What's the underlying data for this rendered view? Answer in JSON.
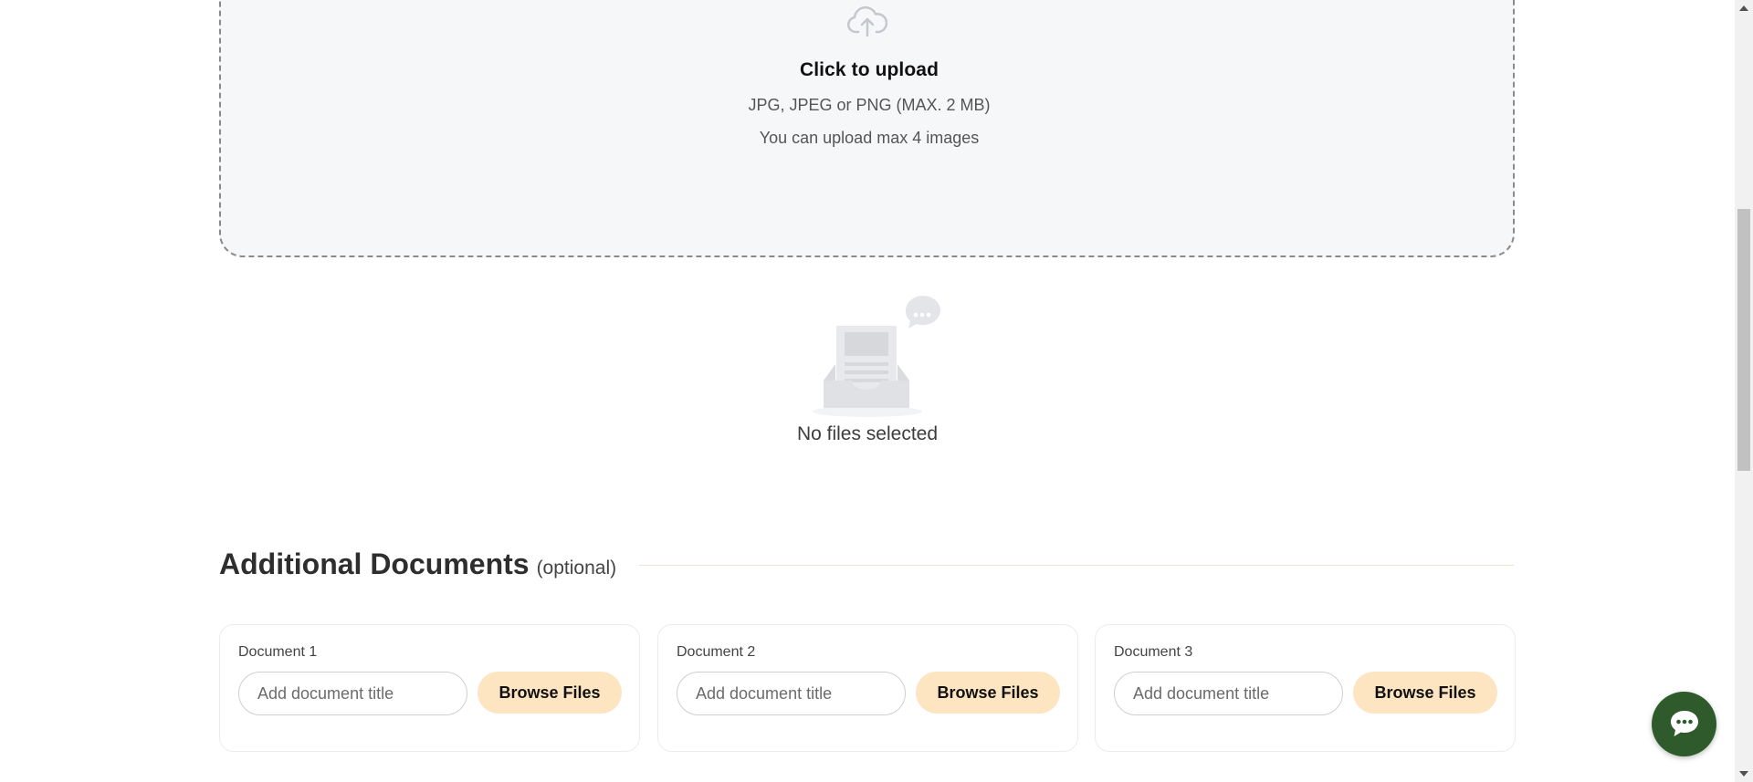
{
  "upload": {
    "title": "Click to upload",
    "formats": "JPG, JPEG or PNG (MAX. 2 MB)",
    "limit": "You can upload max 4 images",
    "icon": "cloud-upload-icon"
  },
  "empty_state": {
    "text": "No files selected",
    "icon": "empty-inbox-icon"
  },
  "additional_documents": {
    "title": "Additional Documents",
    "optional_label": "(optional)",
    "documents": [
      {
        "label": "Document 1",
        "placeholder": "Add document title",
        "button": "Browse Files"
      },
      {
        "label": "Document 2",
        "placeholder": "Add document title",
        "button": "Browse Files"
      },
      {
        "label": "Document 3",
        "placeholder": "Add document title",
        "button": "Browse Files"
      }
    ]
  },
  "chat": {
    "icon": "chat-bubble-icon"
  },
  "colors": {
    "browse_button_bg": "#fde5c2",
    "chat_button_bg": "#2f5a2b",
    "upload_zone_bg": "#f6f7f9"
  }
}
